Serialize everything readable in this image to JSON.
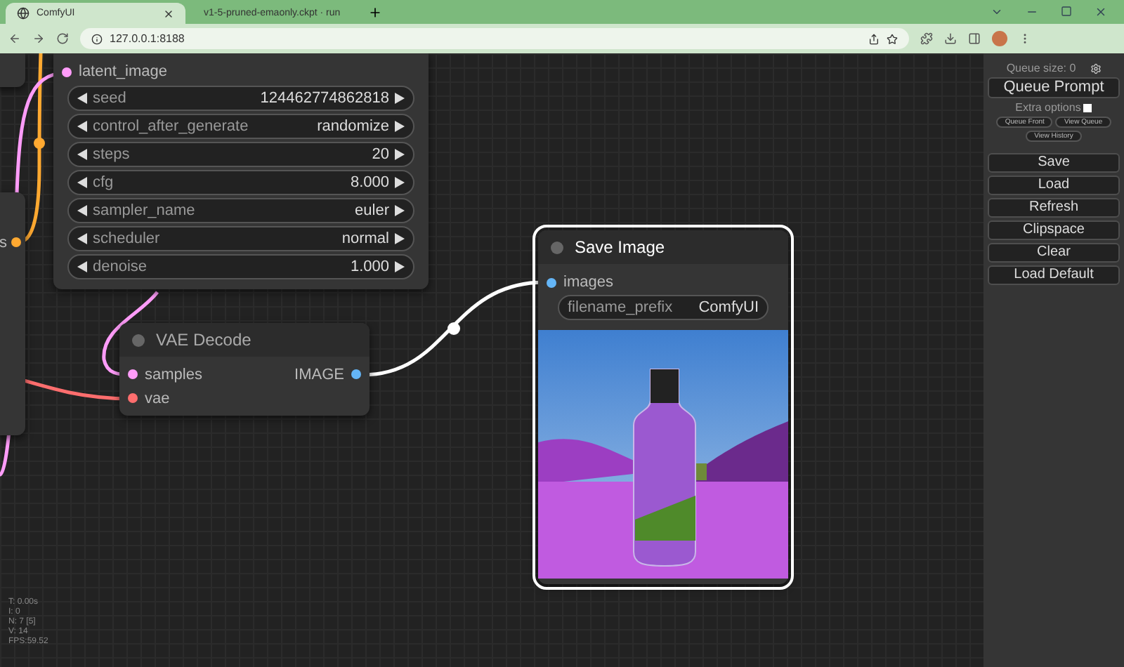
{
  "browser": {
    "tabs": [
      {
        "title": "ComfyUI",
        "selected": true,
        "kind": "globe"
      },
      {
        "title": "v1-5-pruned-emaonly.ckpt · run",
        "selected": false,
        "kind": "emoji"
      }
    ],
    "url": "127.0.0.1:8188"
  },
  "canvas": {
    "side_output": {
      "label": "s",
      "color": "#ffa931"
    },
    "ksampler": {
      "inputs": [
        {
          "label": "latent_image",
          "color": "#ff9cf9"
        }
      ],
      "widgets": [
        {
          "name": "seed",
          "value": "124462774862818"
        },
        {
          "name": "control_after_generate",
          "value": "randomize"
        },
        {
          "name": "steps",
          "value": "20"
        },
        {
          "name": "cfg",
          "value": "8.000"
        },
        {
          "name": "sampler_name",
          "value": "euler"
        },
        {
          "name": "scheduler",
          "value": "normal"
        },
        {
          "name": "denoise",
          "value": "1.000"
        }
      ]
    },
    "vae_decode": {
      "title": "VAE Decode",
      "selected": false,
      "inputs": [
        {
          "label": "samples",
          "color": "#ff9cf9"
        },
        {
          "label": "vae",
          "color": "#ff6e6e"
        }
      ],
      "outputs": [
        {
          "label": "IMAGE",
          "color": "#64b5f6"
        }
      ]
    },
    "save_image": {
      "title": "Save Image",
      "selected": true,
      "inputs": [
        {
          "label": "images",
          "color": "#64b5f6"
        }
      ],
      "widgets": [
        {
          "name": "filename_prefix",
          "value": "ComfyUI"
        }
      ]
    },
    "stats": [
      "T: 0.00s",
      "I: 0",
      "N: 7 [5]",
      "V: 14",
      "FPS:59.52"
    ]
  },
  "menu": {
    "queue_size": "Queue size: 0",
    "queue_button": "Queue Prompt",
    "extra_options": {
      "label": "Extra options",
      "checked": false
    },
    "small_buttons": [
      [
        "Queue Front",
        "View Queue"
      ],
      [
        "View History"
      ]
    ],
    "buttons": [
      "Save",
      "Load",
      "Refresh",
      "Clipspace",
      "Clear",
      "Load Default"
    ]
  }
}
